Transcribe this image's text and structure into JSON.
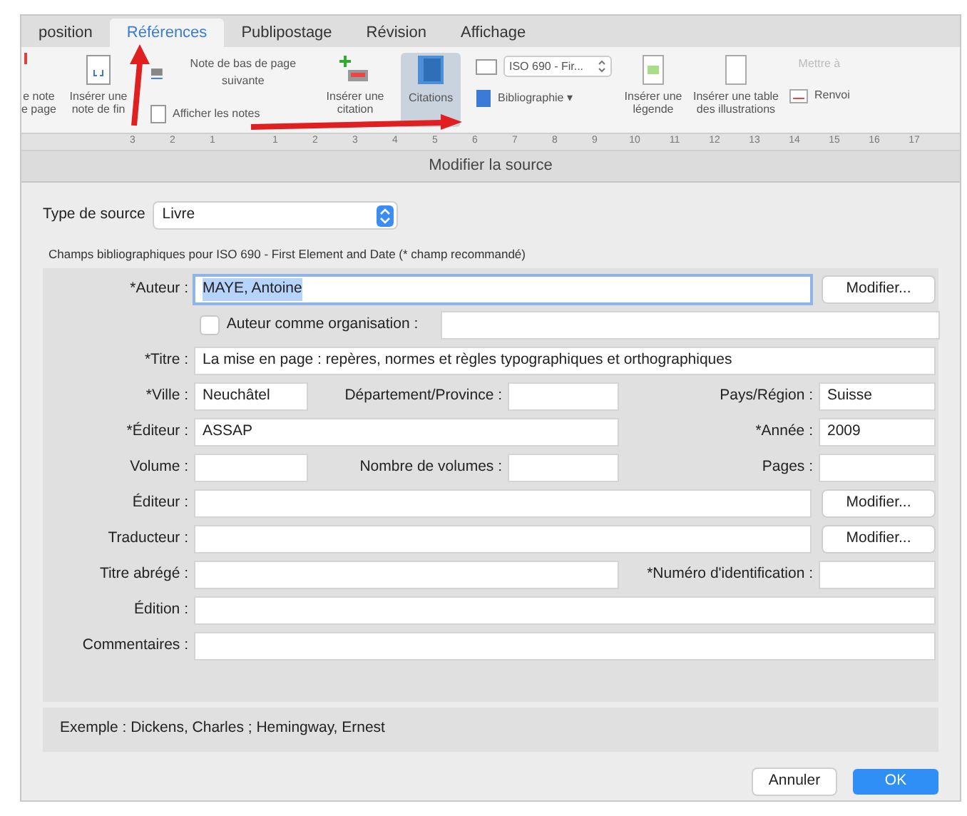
{
  "tabs": [
    {
      "label": "position",
      "selected": false
    },
    {
      "label": "Références",
      "selected": true
    },
    {
      "label": "Publipostage",
      "selected": false
    },
    {
      "label": "Révision",
      "selected": false
    },
    {
      "label": "Affichage",
      "selected": false
    }
  ],
  "ribbon": {
    "cut_item": "e note\ne page",
    "endnote": "Insérer une\nnote de fin",
    "next_footnote": "Note de bas de page suivante",
    "show_notes": "Afficher les notes",
    "insert_citation": "Insérer une\ncitation",
    "citations": {
      "label": "Citations",
      "selected": true
    },
    "style": "ISO 690 - Fir...",
    "bibliography": "Bibliographie ▾",
    "caption": "Insérer une\nlégende",
    "table": "Insérer une table\ndes illustrations",
    "update": {
      "label": "Mettre à",
      "disabled": true
    },
    "crossref": "Renvoi"
  },
  "ruler": [
    "3",
    "2",
    "1",
    "1",
    "2",
    "3",
    "4",
    "5",
    "6",
    "7",
    "8",
    "9",
    "10",
    "11",
    "12",
    "13",
    "14",
    "15",
    "16",
    "17"
  ],
  "dialog": {
    "title": "Modifier la source",
    "source_type_label": "Type de source",
    "source_type": "Livre",
    "section_title": "Champs bibliographiques pour ISO 690 - First Element and Date  (* champ recommandé)",
    "rows": [
      {
        "kind": "wide_button",
        "fields": [
          {
            "label": "*Auteur :",
            "value": "MAYE, Antoine",
            "focused": true
          }
        ],
        "button": "Modifier..."
      },
      {
        "kind": "checkbox",
        "label": "Auteur  comme organisation :",
        "checked": false
      },
      {
        "kind": "wide",
        "fields": [
          {
            "label": "*Titre :",
            "value": "La mise en page : repères, normes et règles typographiques et orthographiques"
          }
        ]
      },
      {
        "kind": "triple",
        "fields": [
          {
            "label": "*Ville :",
            "value": "Neuchâtel"
          },
          {
            "label": "Département/Province :"
          },
          {
            "label": "Pays/Région :",
            "value": "Suisse"
          }
        ]
      },
      {
        "kind": "pair",
        "fields": [
          {
            "label": "*Éditeur :",
            "value": "ASSAP"
          },
          {
            "label": "*Année :",
            "value": "2009"
          }
        ]
      },
      {
        "kind": "triple",
        "fields": [
          {
            "label": "Volume :"
          },
          {
            "label": "Nombre de volumes :"
          },
          {
            "label": "Pages :"
          }
        ]
      },
      {
        "kind": "wide_button",
        "fields": [
          {
            "label": "Éditeur :"
          }
        ],
        "button": "Modifier..."
      },
      {
        "kind": "wide_button",
        "fields": [
          {
            "label": "Traducteur :"
          }
        ],
        "button": "Modifier..."
      },
      {
        "kind": "pair",
        "fields": [
          {
            "label": "Titre abrégé :"
          },
          {
            "label": "*Numéro d'identification :"
          }
        ]
      },
      {
        "kind": "wide",
        "fields": [
          {
            "label": "Édition :"
          }
        ]
      },
      {
        "kind": "wide",
        "fields": [
          {
            "label": "Commentaires :"
          }
        ]
      }
    ],
    "example": "Exemple : Dickens, Charles ; Hemingway, Ernest",
    "buttons": [
      {
        "label": "Annuler",
        "kind": "cancel"
      },
      {
        "label": "OK",
        "kind": "default"
      }
    ]
  }
}
